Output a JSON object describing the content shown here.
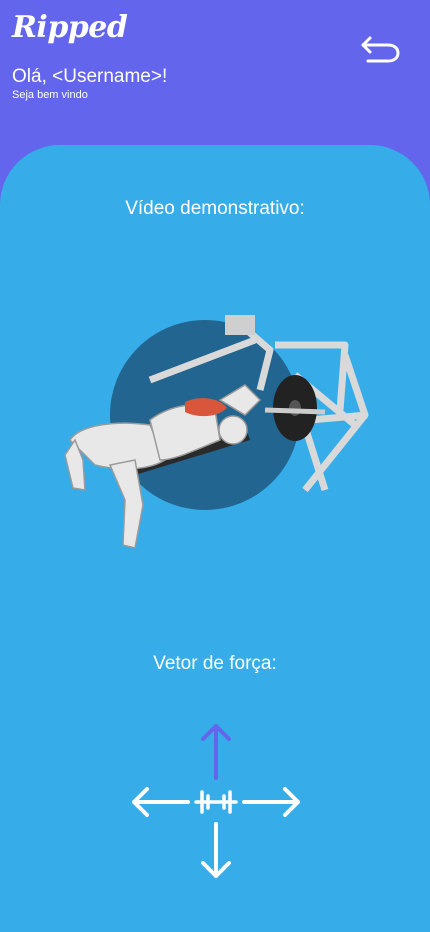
{
  "app": {
    "logo": "Ripped"
  },
  "header": {
    "greeting": "Olá, <Username>!",
    "subtitle": "Seja bem vindo"
  },
  "icons": {
    "back": "back-arrow-icon",
    "dumbbell": "dumbbell-icon"
  },
  "colors": {
    "header_bg": "#6366ec",
    "panel_bg": "#36ade9",
    "active_arrow": "#6366ec",
    "inactive_arrow": "#ffffff",
    "muscle_highlight": "#d9553b"
  },
  "sections": {
    "video_title": "Vídeo demonstrativo:",
    "vector_title": "Vetor de força:"
  },
  "force_vector": {
    "active_direction": "up",
    "directions": [
      "up",
      "left",
      "right",
      "down"
    ]
  }
}
